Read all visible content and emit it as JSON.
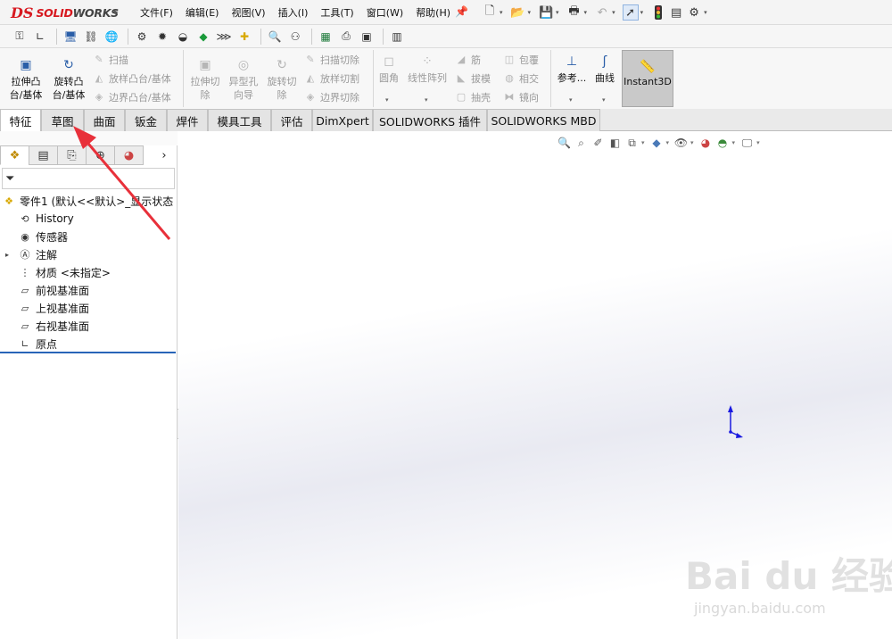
{
  "app": {
    "logo_ds": "DS",
    "logo_text_a": "SOLID",
    "logo_text_b": "WORKS"
  },
  "menu": [
    "文件(F)",
    "编辑(E)",
    "视图(V)",
    "插入(I)",
    "工具(T)",
    "窗口(W)",
    "帮助(H)"
  ],
  "ribbon": {
    "extrude_boss": "拉伸凸\n台/基体",
    "revolve_boss": "旋转凸\n台/基体",
    "sweep": "扫描",
    "loft": "放样凸台/基体",
    "boundary": "边界凸台/基体",
    "extrude_cut": "拉伸切\n除",
    "hole_wizard": "异型孔\n向导",
    "revolve_cut": "旋转切\n除",
    "swept_cut": "扫描切除",
    "lofted_cut": "放样切割",
    "boundary_cut": "边界切除",
    "fillet": "圆角",
    "linear_pattern": "线性阵列",
    "rib": "筋",
    "draft": "拔模",
    "shell": "抽壳",
    "wrap": "包覆",
    "intersect": "相交",
    "mirror": "镜向",
    "reference": "参考...",
    "curves": "曲线",
    "instant3d": "Instant3D"
  },
  "tabs": [
    "特征",
    "草图",
    "曲面",
    "钣金",
    "焊件",
    "模具工具",
    "评估",
    "DimXpert",
    "SOLIDWORKS 插件",
    "SOLIDWORKS MBD"
  ],
  "active_tab": "特征",
  "tree": {
    "root": "零件1  (默认<<默认>_显示状态",
    "items": [
      "History",
      "传感器",
      "注解",
      "材质 <未指定>",
      "前视基准面",
      "上视基准面",
      "右视基准面",
      "原点"
    ]
  },
  "panel_more": "›",
  "watermark": {
    "main": "Bai du 经验",
    "sub": "jingyan.baidu.com"
  },
  "colors": {
    "brand_red": "#d71920",
    "accent_blue": "#2864b8",
    "annotation_red": "#e8303a"
  }
}
